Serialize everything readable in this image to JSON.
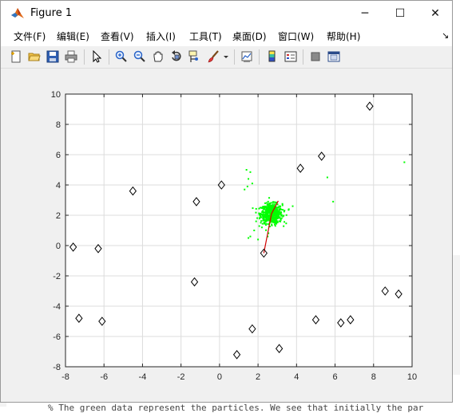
{
  "background": {
    "bottom_text": "% The green data represent the particles.  We see that initially the par"
  },
  "window": {
    "title": "Figure 1",
    "app_icon": "matlab-logo-icon",
    "controls": {
      "minimize": "─",
      "maximize": "☐",
      "close": "✕"
    }
  },
  "menu": {
    "items": [
      "文件(F)",
      "编辑(E)",
      "查看(V)",
      "插入(I)",
      "工具(T)",
      "桌面(D)",
      "窗口(W)",
      "帮助(H)"
    ],
    "dock_symbol": "↘"
  },
  "toolbar": {
    "buttons": [
      "new-figure-icon",
      "open-file-icon",
      "save-icon",
      "print-icon",
      "pointer-icon",
      "zoom-in-icon",
      "zoom-out-icon",
      "pan-icon",
      "rotate-3d-icon",
      "data-cursor-icon",
      "brush-icon",
      "brush-dropdown-icon",
      "link-plot-icon",
      "colorbar-icon",
      "legend-icon",
      "hide-plot-tools-icon",
      "show-plot-tools-icon"
    ]
  },
  "chart_data": {
    "type": "scatter",
    "title": "",
    "xlabel": "",
    "ylabel": "",
    "xlim": [
      -8,
      10
    ],
    "ylim": [
      -8,
      10
    ],
    "xticks": [
      -8,
      -6,
      -4,
      -2,
      0,
      2,
      4,
      6,
      8,
      10
    ],
    "yticks": [
      -8,
      -6,
      -4,
      -2,
      0,
      2,
      4,
      6,
      8,
      10
    ],
    "grid": true,
    "colors": {
      "landmarks": "#000000",
      "particles": "#00ff00",
      "path": "#d00000",
      "grid": "#dcdcdc",
      "axes_bg": "#ffffff"
    },
    "landmarks": [
      [
        -7.6,
        -0.1
      ],
      [
        -6.3,
        -0.2
      ],
      [
        -7.3,
        -4.8
      ],
      [
        -6.1,
        -5.0
      ],
      [
        -4.5,
        3.6
      ],
      [
        -1.2,
        2.9
      ],
      [
        -1.3,
        -2.4
      ],
      [
        0.1,
        4.0
      ],
      [
        0.9,
        -7.2
      ],
      [
        1.7,
        -5.5
      ],
      [
        2.3,
        -0.5
      ],
      [
        3.1,
        -6.8
      ],
      [
        4.2,
        5.1
      ],
      [
        5.0,
        -4.9
      ],
      [
        5.3,
        5.9
      ],
      [
        6.3,
        -5.1
      ],
      [
        6.8,
        -4.9
      ],
      [
        7.8,
        9.2
      ],
      [
        8.6,
        -3.0
      ],
      [
        9.3,
        -3.2
      ]
    ],
    "path": [
      [
        2.3,
        -0.5
      ],
      [
        2.7,
        2.1
      ],
      [
        3.05,
        2.95
      ]
    ],
    "particle_cluster": {
      "center": [
        2.7,
        2.1
      ],
      "spread": [
        0.28,
        0.32
      ],
      "count": 600
    },
    "particle_outliers": [
      [
        1.4,
        5.0
      ],
      [
        1.6,
        4.85
      ],
      [
        1.5,
        4.4
      ],
      [
        1.3,
        3.7
      ],
      [
        1.45,
        3.9
      ],
      [
        1.7,
        4.1
      ],
      [
        5.6,
        4.5
      ],
      [
        9.6,
        5.5
      ],
      [
        5.9,
        2.9
      ],
      [
        3.6,
        2.4
      ],
      [
        3.8,
        2.6
      ],
      [
        1.6,
        0.6
      ],
      [
        2.0,
        0.4
      ],
      [
        1.5,
        0.5
      ],
      [
        2.2,
        1.2
      ],
      [
        2.4,
        1.7
      ],
      [
        1.9,
        1.6
      ],
      [
        2.9,
        1.3
      ],
      [
        2.5,
        0.6
      ],
      [
        1.8,
        1.0
      ]
    ]
  }
}
